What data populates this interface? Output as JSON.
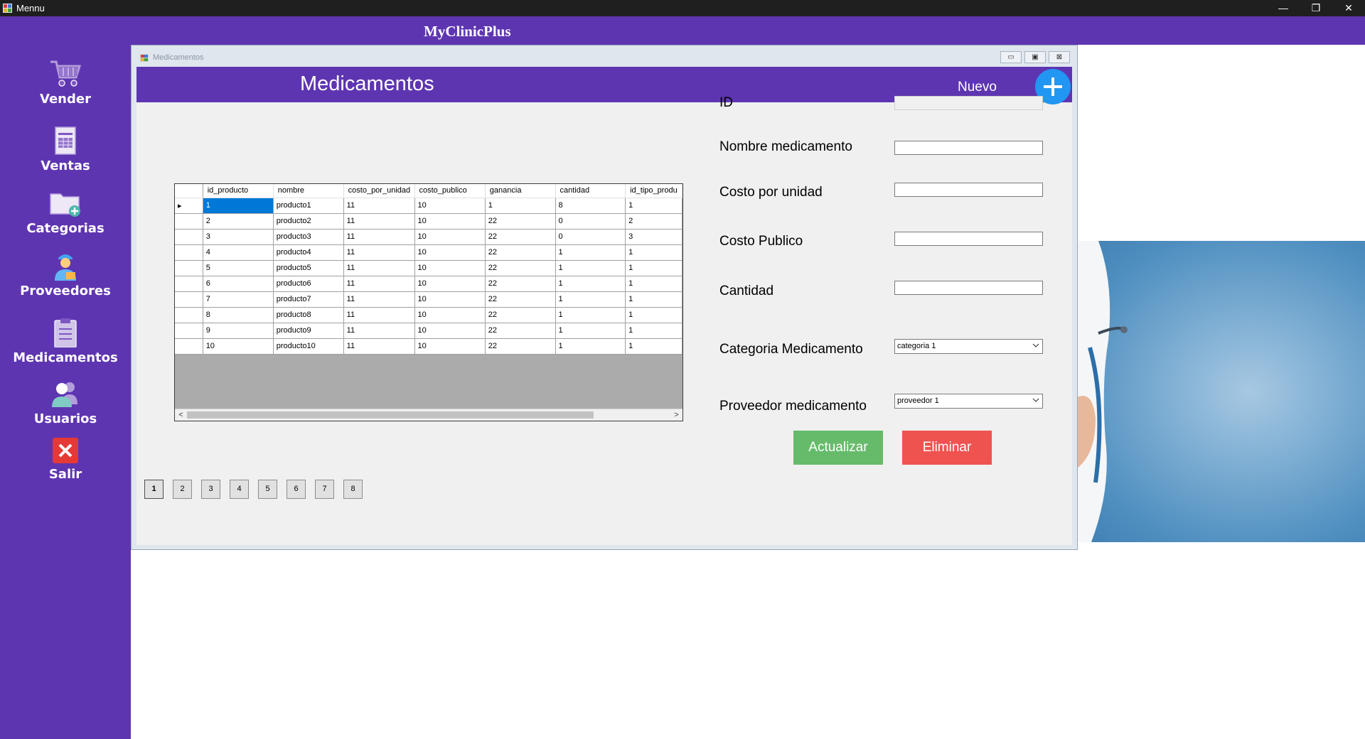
{
  "window": {
    "title": "Mennu",
    "controls": {
      "minimize": "—",
      "restore": "❐",
      "close": "✕"
    }
  },
  "header": {
    "brand": "MyClinicPlus"
  },
  "sidebar": {
    "items": [
      {
        "label": "Vender",
        "icon": "cart-icon"
      },
      {
        "label": "Ventas",
        "icon": "spreadsheet-icon"
      },
      {
        "label": "Categorias",
        "icon": "folder-add-icon"
      },
      {
        "label": "Proveedores",
        "icon": "delivery-person-icon"
      },
      {
        "label": "Medicamentos",
        "icon": "clipboard-icon"
      },
      {
        "label": "Usuarios",
        "icon": "users-icon"
      },
      {
        "label": "Salir",
        "icon": "exit-icon"
      }
    ]
  },
  "child_window": {
    "title": "Medicamentos",
    "controls": {
      "minimize": "▭",
      "maximize": "▣",
      "close": "⊠"
    }
  },
  "form_header": {
    "title": "Medicamentos",
    "new_label": "Nuevo"
  },
  "grid": {
    "columns": [
      "id_producto",
      "nombre",
      "costo_por_unidad",
      "costo_publico",
      "ganancia",
      "cantidad",
      "id_tipo_produ"
    ],
    "rows": [
      [
        "1",
        "producto1",
        "11",
        "10",
        "1",
        "8",
        "1"
      ],
      [
        "2",
        "producto2",
        "11",
        "10",
        "22",
        "0",
        "2"
      ],
      [
        "3",
        "producto3",
        "11",
        "10",
        "22",
        "0",
        "3"
      ],
      [
        "4",
        "producto4",
        "11",
        "10",
        "22",
        "1",
        "1"
      ],
      [
        "5",
        "producto5",
        "11",
        "10",
        "22",
        "1",
        "1"
      ],
      [
        "6",
        "producto6",
        "11",
        "10",
        "22",
        "1",
        "1"
      ],
      [
        "7",
        "producto7",
        "11",
        "10",
        "22",
        "1",
        "1"
      ],
      [
        "8",
        "producto8",
        "11",
        "10",
        "22",
        "1",
        "1"
      ],
      [
        "9",
        "producto9",
        "11",
        "10",
        "22",
        "1",
        "1"
      ],
      [
        "10",
        "producto10",
        "11",
        "10",
        "22",
        "1",
        "1"
      ]
    ],
    "selected_row": 0,
    "scroll": {
      "left": "<",
      "right": ">"
    },
    "row_indicator": "▸"
  },
  "form": {
    "id_label": "ID",
    "id_value": "",
    "name_label": "Nombre medicamento",
    "name_value": "",
    "unit_cost_label": "Costo por unidad",
    "unit_cost_value": "",
    "public_cost_label": "Costo Publico",
    "public_cost_value": "",
    "quantity_label": "Cantidad",
    "quantity_value": "",
    "category_label": "Categoria Medicamento",
    "category_value": "categoria 1",
    "provider_label": "Proveedor medicamento",
    "provider_value": "proveedor 1",
    "update_label": "Actualizar",
    "delete_label": "Eliminar"
  },
  "pagination": {
    "pages": [
      "1",
      "2",
      "3",
      "4",
      "5",
      "6",
      "7",
      "8"
    ],
    "current": "1"
  },
  "colors": {
    "brand_purple": "#5e35b1",
    "add_blue": "#2196f3",
    "update_green": "#66bb6a",
    "delete_red": "#ef5350",
    "selection_blue": "#0078d7"
  }
}
